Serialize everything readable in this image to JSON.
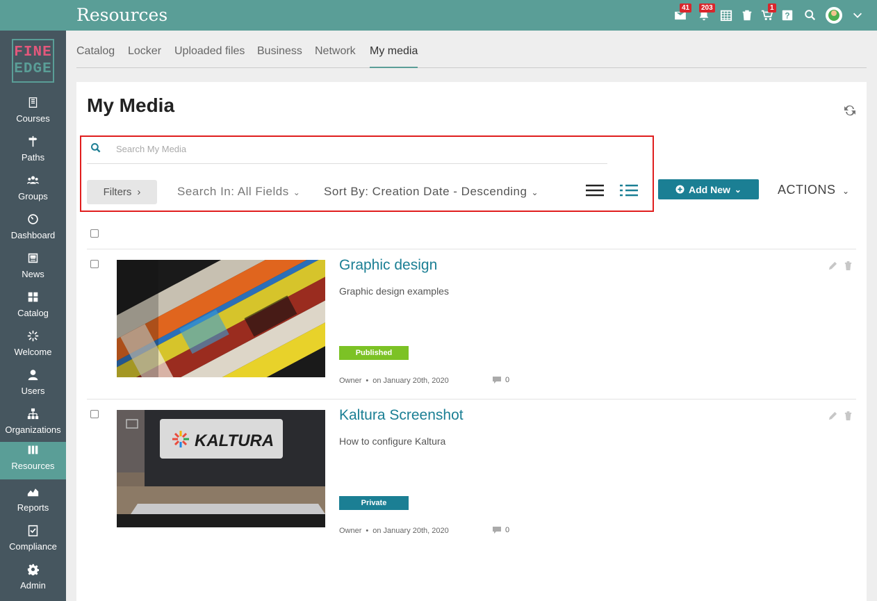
{
  "app": {
    "title": "Resources"
  },
  "topbar": {
    "badges": {
      "messages": "41",
      "notifications": "203",
      "cart": "1"
    }
  },
  "sidebar": {
    "logo": {
      "line1": "FINE",
      "line2": "EDGE"
    },
    "items": [
      {
        "label": "Courses"
      },
      {
        "label": "Paths"
      },
      {
        "label": "Groups"
      },
      {
        "label": "Dashboard"
      },
      {
        "label": "News"
      },
      {
        "label": "Catalog"
      },
      {
        "label": "Welcome"
      },
      {
        "label": "Users"
      },
      {
        "label": "Organizations"
      },
      {
        "label": "Resources"
      },
      {
        "label": "Reports"
      },
      {
        "label": "Compliance"
      },
      {
        "label": "Admin"
      }
    ]
  },
  "tabs": [
    {
      "label": "Catalog"
    },
    {
      "label": "Locker"
    },
    {
      "label": "Uploaded files"
    },
    {
      "label": "Business"
    },
    {
      "label": "Network"
    },
    {
      "label": "My media"
    }
  ],
  "main": {
    "title": "My Media",
    "search": {
      "placeholder": "Search My Media",
      "value": ""
    },
    "filters_label": "Filters",
    "search_in": "Search In: All Fields",
    "sort_by": "Sort By: Creation Date - Descending",
    "add_new_label": "Add New",
    "actions_label": "ACTIONS"
  },
  "media": [
    {
      "title": "Graphic design",
      "description": "Graphic design examples",
      "status": "Published",
      "owner": "Owner",
      "date": "on January 20th, 2020",
      "comments": "0"
    },
    {
      "title": "Kaltura Screenshot",
      "description": "How to configure Kaltura",
      "status": "Private",
      "owner": "Owner",
      "date": "on January 20th, 2020",
      "comments": "0",
      "thumb_logo_text": "KALTURA"
    }
  ],
  "colors": {
    "brand": "#5a9e97",
    "sidebar": "#46565f",
    "accent": "#1b7f94",
    "published": "#7cc225",
    "highlight": "#e01e1e"
  }
}
